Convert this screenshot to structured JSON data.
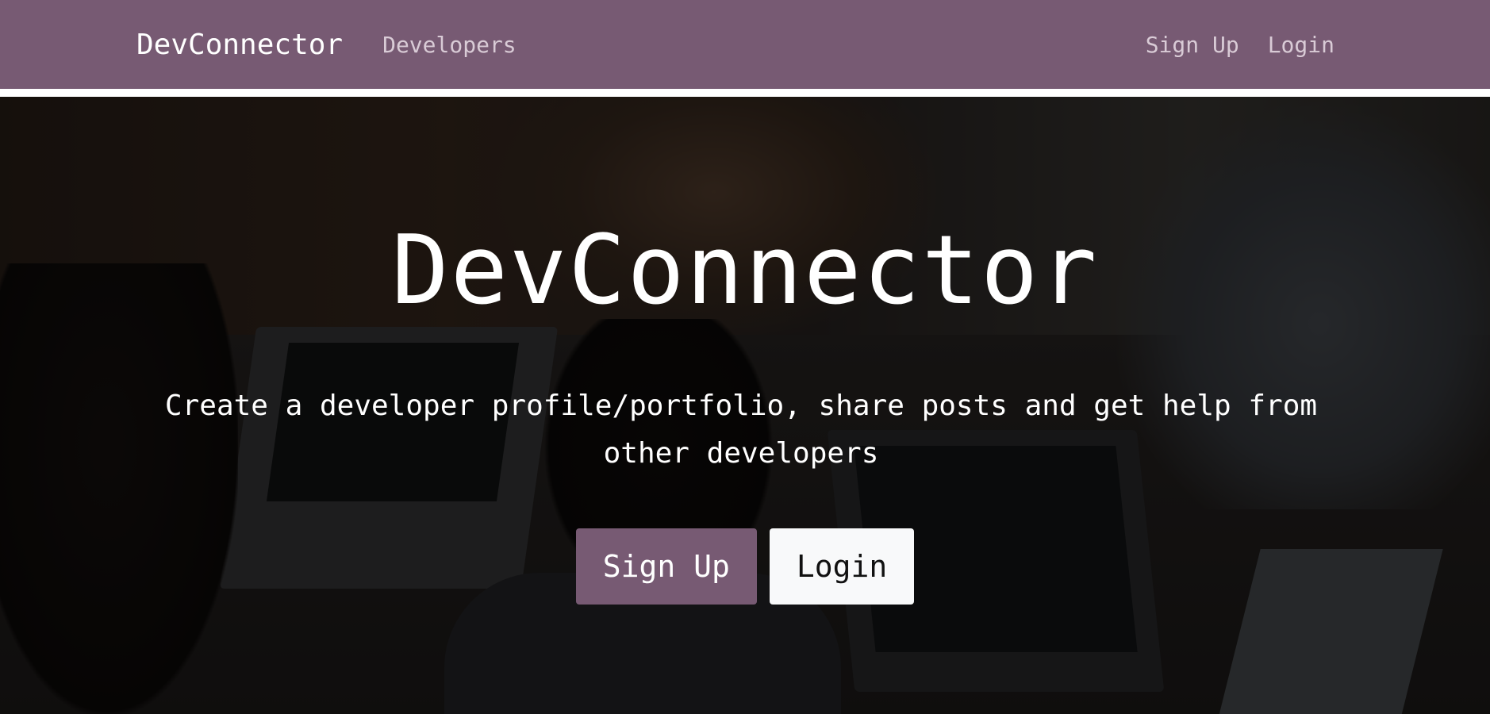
{
  "navbar": {
    "brand": "DevConnector",
    "links": [
      {
        "label": "Developers"
      }
    ],
    "right_links": [
      {
        "label": "Sign Up"
      },
      {
        "label": "Login"
      }
    ]
  },
  "hero": {
    "title": "DevConnector",
    "subtitle": "Create a developer profile/portfolio, share posts and get help from other developers",
    "buttons": {
      "signup_label": "Sign Up",
      "login_label": "Login"
    }
  },
  "colors": {
    "brand": "#775a73",
    "light_button": "#f8f9fa",
    "text_on_dark": "#ffffff"
  }
}
